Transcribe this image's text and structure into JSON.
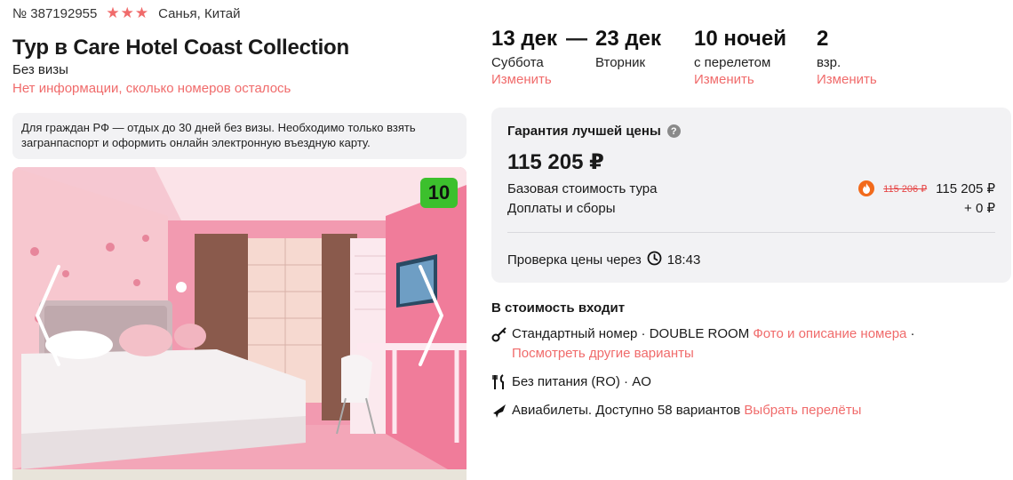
{
  "hotel": {
    "tour_number": "№ 387192955",
    "stars": "★★★",
    "location": "Санья, Китай",
    "title": "Тур в Care Hotel Coast Collection",
    "visa": "Без визы",
    "rooms_notice": "Нет информации, сколько номеров осталось",
    "visa_note": "Для граждан РФ — отдых до 30 дней без визы. Необходимо только взять загранпаспорт и оформить онлайн электронную въездную карту.",
    "rating": "10"
  },
  "dates": {
    "from_date": "13 дек",
    "from_day": "Суббота",
    "dash": "—",
    "to_date": "23 дек",
    "to_day": "Вторник",
    "nights": "10 ночей",
    "nights_note": "с перелетом",
    "guests": "2",
    "guests_note": "взр.",
    "change_label": "Изменить"
  },
  "price": {
    "guarantee": "Гарантия лучшей цены",
    "help_icon": "?",
    "total": "115 205 ₽",
    "base_label": "Базовая стоимость тура",
    "base_old": "115 206 ₽",
    "base_value": "115 205 ₽",
    "fees_label": "Доплаты и сборы",
    "fees_value": "+ 0 ₽",
    "check_label": "Проверка цены через",
    "check_time": "18:43"
  },
  "includes": {
    "title": "В стоимость входит",
    "room_text": "Стандартный номер · DOUBLE ROOM",
    "room_link": "Фото и описание номера",
    "room_sep": " ·",
    "room_other_link": "Посмотреть другие варианты",
    "meal_text": "Без питания (RO) · AO",
    "flight_text": "Авиабилеты. Доступно 58 вариантов",
    "flight_link": "Выбрать перелёты"
  },
  "icons": {
    "star": "star-icon",
    "help": "help-icon",
    "fire": "fire-icon",
    "clock": "clock-icon",
    "key": "key-icon",
    "meal": "fork-knife-icon",
    "plane": "plane-icon",
    "prev": "chevron-left-icon",
    "next": "chevron-right-icon"
  },
  "colors": {
    "accent": "#f06b6b",
    "rating_badge": "#3cc02d",
    "card_bg": "#f2f2f4",
    "old_price": "#e64545"
  }
}
